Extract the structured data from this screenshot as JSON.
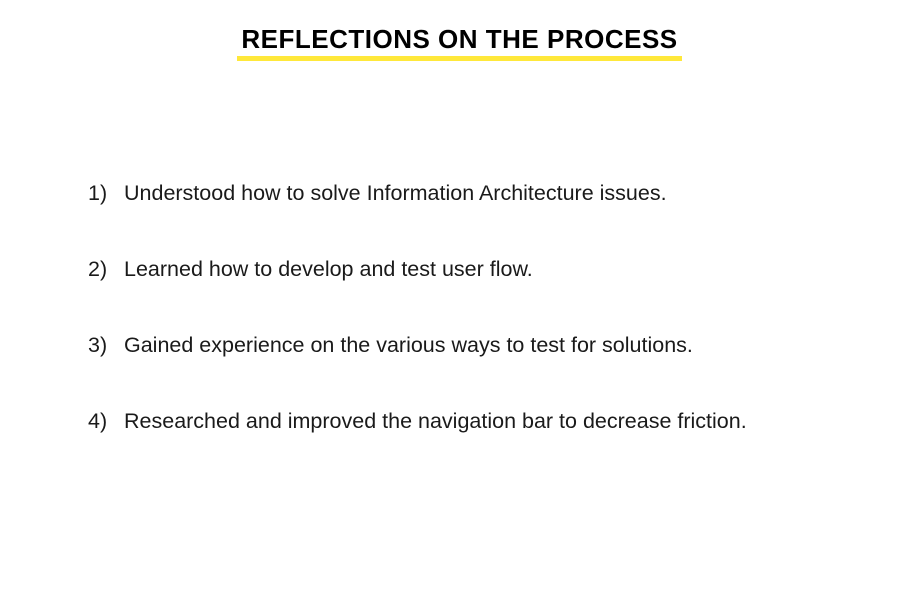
{
  "slide": {
    "title": "REFLECTIONS ON THE PROCESS",
    "accent_color": "#ffe83a",
    "items": [
      {
        "number": "1)",
        "text": "Understood how to solve Information Architecture issues."
      },
      {
        "number": "2)",
        "text": "Learned how to develop and test user flow."
      },
      {
        "number": "3)",
        "text": "Gained experience on the various ways to test for solutions."
      },
      {
        "number": "4)",
        "text": "Researched and improved the navigation bar to decrease friction."
      }
    ]
  }
}
